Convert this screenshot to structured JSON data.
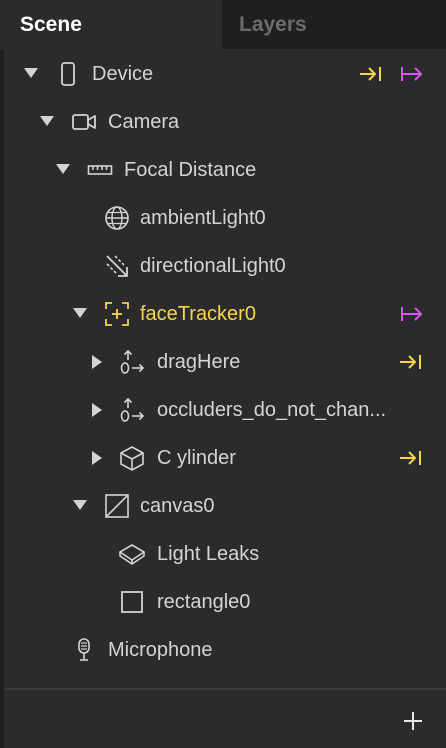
{
  "tabs": [
    {
      "label": "Scene",
      "active": true
    },
    {
      "label": "Layers",
      "active": false
    }
  ],
  "tree": [
    {
      "label": "Device",
      "icon": "phone-icon",
      "caret": "expanded",
      "indent": 0,
      "badges": [
        "export-yellow-icon",
        "export-magenta-icon"
      ]
    },
    {
      "label": "Camera",
      "icon": "camera-icon",
      "caret": "expanded",
      "indent": 1
    },
    {
      "label": "Focal Distance",
      "icon": "ruler-icon",
      "caret": "expanded",
      "indent": 2
    },
    {
      "label": "ambientLight0",
      "icon": "globe-light-icon",
      "caret": "none",
      "indent": 3
    },
    {
      "label": "directionalLight0",
      "icon": "directional-light-icon",
      "caret": "none",
      "indent": 3
    },
    {
      "label": "faceTracker0",
      "icon": "face-tracker-icon",
      "caret": "expanded",
      "indent": 3,
      "highlight": "#f5d64a",
      "badges": [
        "export-magenta-icon"
      ]
    },
    {
      "label": "dragHere",
      "icon": "null-object-icon",
      "caret": "collapsed",
      "indent": 4,
      "badges": [
        "export-yellow-icon"
      ]
    },
    {
      "label": "occluders_do_not_chan...",
      "icon": "null-object-icon",
      "caret": "collapsed",
      "indent": 4
    },
    {
      "label": "C ylinder",
      "icon": "cube-icon",
      "caret": "collapsed",
      "indent": 4,
      "badges": [
        "export-yellow-icon"
      ]
    },
    {
      "label": "canvas0",
      "icon": "canvas-icon",
      "caret": "expanded",
      "indent": 3
    },
    {
      "label": "Light Leaks",
      "icon": "plane-icon",
      "caret": "none",
      "indent": 4
    },
    {
      "label": "rectangle0",
      "icon": "rectangle-icon",
      "caret": "none",
      "indent": 4
    },
    {
      "label": "Microphone",
      "icon": "microphone-icon",
      "caret": "none",
      "indent": 1
    }
  ],
  "colors": {
    "accent_yellow": "#f5d64a",
    "accent_magenta": "#d35ce6",
    "text": "#d4d4d6",
    "background": "#2b2b2d"
  },
  "footer": {
    "add_icon": "plus-icon"
  }
}
